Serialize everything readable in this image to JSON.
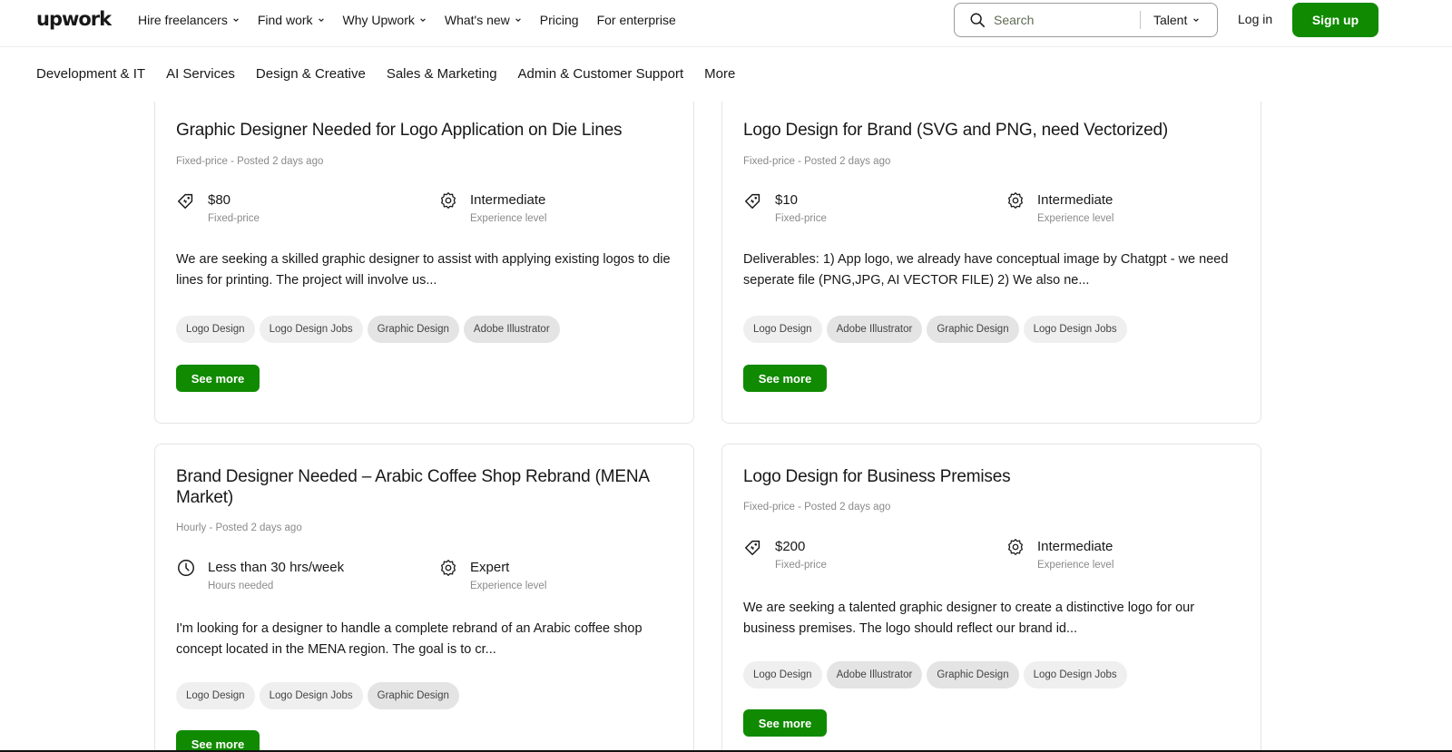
{
  "header": {
    "logo": "upwork",
    "nav": [
      "Hire freelancers",
      "Find work",
      "Why Upwork",
      "What's new",
      "Pricing",
      "For enterprise"
    ],
    "search": {
      "placeholder": "Search",
      "scope": "Talent"
    },
    "login": "Log in",
    "signup": "Sign up"
  },
  "categories": [
    "Development & IT",
    "AI Services",
    "Design & Creative",
    "Sales & Marketing",
    "Admin & Customer Support",
    "More"
  ],
  "jobs": [
    {
      "title": "Graphic Designer Needed for Logo Application on Die Lines",
      "posted": "Fixed-price - Posted 2 days ago",
      "budget_value": "$80",
      "budget_label": "Fixed-price",
      "level_value": "Intermediate",
      "level_label": "Experience level",
      "description": "We are seeking a skilled graphic designer to assist with applying existing logos to die lines for printing. The project will involve us...",
      "tags": [
        "Logo Design",
        "Logo Design Jobs",
        "Graphic Design",
        "Adobe Illustrator"
      ],
      "cta": "See more"
    },
    {
      "title": "Logo Design for Brand (SVG and PNG, need Vectorized)",
      "posted": "Fixed-price - Posted 2 days ago",
      "budget_value": "$10",
      "budget_label": "Fixed-price",
      "level_value": "Intermediate",
      "level_label": "Experience level",
      "description": "Deliverables: 1) App logo, we already have conceptual image by Chatgpt - we need seperate file (PNG,JPG, AI VECTOR FILE) 2) We also ne...",
      "tags": [
        "Logo Design",
        "Adobe Illustrator",
        "Graphic Design",
        "Logo Design Jobs"
      ],
      "cta": "See more"
    },
    {
      "title": "Brand Designer Needed – Arabic Coffee Shop Rebrand (MENA Market)",
      "posted": "Hourly - Posted 2 days ago",
      "budget_value": "Less than 30 hrs/week",
      "budget_label": "Hours needed",
      "level_value": "Expert",
      "level_label": "Experience level",
      "description": "I'm looking for a designer to handle a complete rebrand of an Arabic coffee shop concept located in the MENA region. The goal is to cr...",
      "tags": [
        "Logo Design",
        "Logo Design Jobs",
        "Graphic Design"
      ],
      "cta": "See more"
    },
    {
      "title": "Logo Design for Business Premises",
      "posted": "Fixed-price - Posted 2 days ago",
      "budget_value": "$200",
      "budget_label": "Fixed-price",
      "level_value": "Intermediate",
      "level_label": "Experience level",
      "description": "We are seeking a talented graphic designer to create a distinctive logo for our business premises. The logo should reflect our brand id...",
      "tags": [
        "Logo Design",
        "Adobe Illustrator",
        "Graphic Design",
        "Logo Design Jobs"
      ],
      "cta": "See more"
    }
  ],
  "colors": {
    "brand_green": "#108a00",
    "text": "#181818",
    "muted": "#8a8a8a",
    "tag_bg": "#efefef"
  }
}
